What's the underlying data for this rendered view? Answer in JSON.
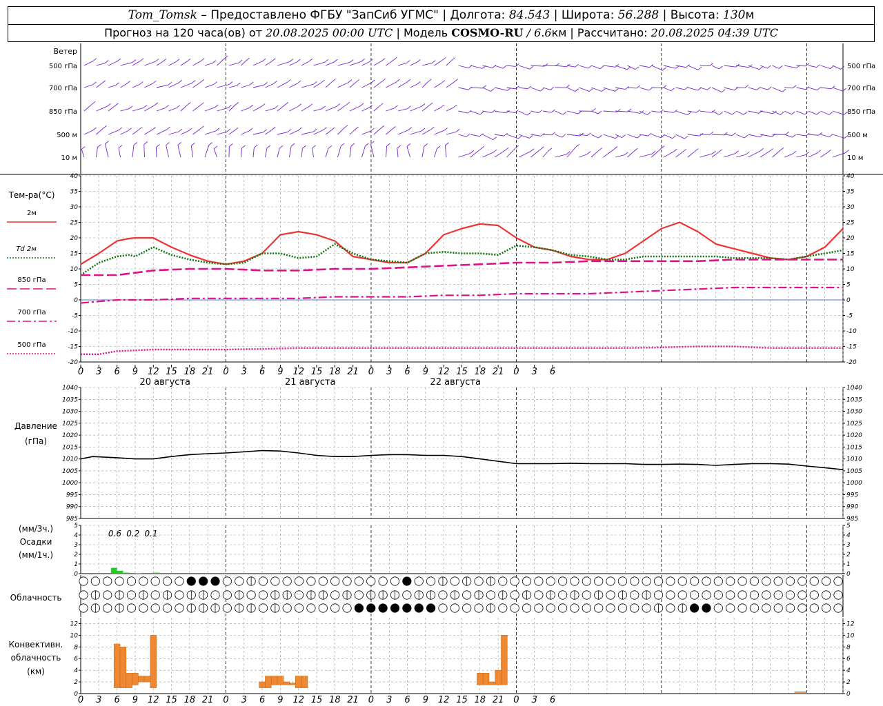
{
  "header": {
    "station": "Tom_Tomsk",
    "provider": " – Предоставлено ФГБУ \"ЗапСиб УГМС\" | Долгота: ",
    "lon": "84.543",
    "lat_label": " | Широта: ",
    "lat": "56.288",
    "alt_label": " | Высота: ",
    "alt": "130",
    "alt_unit": "м",
    "forecast_label": "Прогноз на 120 часа(ов) от ",
    "forecast_time": "20.08.2025 00:00 UTC",
    "model_label": "  | Модель ",
    "model": "COSMO-RU",
    "model_res": " / 6.6",
    "model_res_unit": "км",
    "calc_label": " | Рассчитано: ",
    "calc_time": "20.08.2025 04:39 UTC"
  },
  "labels": {
    "wind": "Ветер",
    "levels": [
      "500 гПа",
      "700 гПа",
      "850 гПа",
      "500 м",
      "10  м"
    ],
    "temp_title": "Тем-ра(°C)",
    "temp_legend": [
      "2м",
      "Td  2м",
      "850 гПа",
      "700 гПа",
      "500 гПа"
    ],
    "pressure_title": "Давление",
    "pressure_unit": "(гПа)",
    "precip_top": "(мм/3ч.)",
    "precip_title": "Осадки",
    "precip_bottom": "(мм/1ч.)",
    "cloud_title": "Облачность",
    "conv_title": [
      "Конвективн.",
      "облачность",
      "(км)"
    ]
  },
  "colors": {
    "t2m": "#ee3333",
    "td2m": "#117711",
    "t850": "#dd1188",
    "t700": "#dd1188",
    "t500": "#dd1188",
    "wind": "#7722cc",
    "precip": "#22cc22",
    "conv": "#ee8833",
    "pressure": "#000000",
    "grid": "#999999"
  },
  "x_ticks": [
    "0",
    "3",
    "6",
    "9",
    "12",
    "15",
    "18",
    "21",
    "0",
    "3",
    "6",
    "9",
    "12",
    "15",
    "18",
    "21",
    "0",
    "3",
    "6",
    "9",
    "12",
    "15",
    "18",
    "21",
    "0",
    "3",
    "6"
  ],
  "day_labels": [
    "20 августа",
    "21 августа",
    "22 августа"
  ],
  "chart_data": [
    {
      "type": "line",
      "title": "Тем-ра(°C)",
      "x_unit": "hours from 20.08.2025 00:00 UTC",
      "ylim": [
        -20,
        40
      ],
      "yticks": [
        -20,
        -15,
        -10,
        -5,
        0,
        5,
        10,
        15,
        20,
        25,
        30,
        35,
        40
      ],
      "series": [
        {
          "name": "2м",
          "style": "solid",
          "x": [
            0,
            3,
            6,
            8,
            9,
            12,
            15,
            18,
            21,
            24,
            27,
            30,
            33,
            36,
            39,
            42,
            45,
            48,
            51,
            54,
            57,
            60,
            63,
            66,
            69,
            72,
            75,
            78,
            81,
            84,
            87,
            90,
            93,
            96,
            99,
            102,
            105,
            108,
            111,
            114,
            117,
            120,
            123,
            126
          ],
          "y": [
            11.5,
            15,
            19,
            19.8,
            20,
            20,
            17,
            14.5,
            12.5,
            11.5,
            12.5,
            15,
            21,
            22,
            21,
            19,
            14,
            13,
            12,
            12,
            15,
            21,
            23,
            24.5,
            24,
            20,
            17,
            16,
            14,
            13,
            13,
            15,
            19,
            23,
            25,
            22,
            18,
            16.5,
            15,
            13.5,
            13,
            14,
            17,
            23
          ]
        },
        {
          "name": "Td  2м",
          "style": "dotted",
          "x": [
            0,
            3,
            6,
            8,
            9,
            12,
            15,
            18,
            21,
            24,
            27,
            30,
            33,
            36,
            39,
            42,
            45,
            48,
            51,
            54,
            57,
            60,
            63,
            66,
            69,
            72,
            75,
            78,
            81,
            84,
            87,
            90,
            93,
            96,
            99,
            102,
            105,
            108,
            111,
            114,
            117,
            120,
            123,
            126
          ],
          "y": [
            8,
            12,
            14,
            14.5,
            14,
            17,
            14.5,
            13,
            12,
            11.5,
            12,
            15,
            15,
            13.5,
            14,
            18,
            15,
            13,
            12.5,
            12,
            15,
            15.5,
            15,
            15,
            14.5,
            17.5,
            17,
            16,
            14.5,
            14,
            13,
            13,
            14,
            14,
            14,
            14,
            14,
            13.5,
            13.5,
            13.5,
            13,
            14,
            15,
            16
          ]
        },
        {
          "name": "850 гПа",
          "style": "longdash",
          "x": [
            0,
            6,
            12,
            18,
            24,
            30,
            36,
            42,
            48,
            54,
            60,
            66,
            72,
            78,
            84,
            90,
            96,
            102,
            108,
            114,
            120,
            126
          ],
          "y": [
            8,
            8,
            9.5,
            10,
            10,
            9.5,
            9.5,
            10,
            10,
            10.5,
            11,
            11.5,
            12,
            12,
            12.5,
            12.5,
            12.5,
            12.5,
            13,
            13,
            13,
            13
          ]
        },
        {
          "name": "700 гПа",
          "style": "dashdot",
          "x": [
            0,
            6,
            12,
            18,
            24,
            30,
            36,
            42,
            48,
            54,
            60,
            66,
            72,
            78,
            84,
            90,
            96,
            102,
            108,
            114,
            120,
            126
          ],
          "y": [
            -1,
            0,
            0,
            0.5,
            0.5,
            0.5,
            0.5,
            1,
            1,
            1,
            1.5,
            1.5,
            2,
            2,
            2,
            2.5,
            3,
            3.5,
            4,
            4,
            4,
            4
          ]
        },
        {
          "name": "500 гПа",
          "style": "dotted",
          "x": [
            0,
            3,
            6,
            12,
            18,
            24,
            30,
            36,
            42,
            48,
            54,
            60,
            66,
            72,
            78,
            84,
            90,
            96,
            102,
            108,
            114,
            120,
            126
          ],
          "y": [
            -17.5,
            -17.5,
            -16.5,
            -16,
            -16,
            -16,
            -15.8,
            -15.5,
            -15.5,
            -15.5,
            -15.5,
            -15.5,
            -15.5,
            -15.5,
            -15.5,
            -15.5,
            -15.5,
            -15.3,
            -15,
            -15,
            -15.5,
            -15.5,
            -15.5
          ]
        }
      ]
    },
    {
      "type": "line",
      "title": "Давление",
      "ylabel": "(гПа)",
      "ylim": [
        985,
        1040
      ],
      "yticks": [
        985,
        990,
        995,
        1000,
        1005,
        1010,
        1015,
        1020,
        1025,
        1030,
        1035,
        1040
      ],
      "series": [
        {
          "name": "",
          "x": [
            0,
            2,
            6,
            9,
            12,
            15,
            18,
            21,
            24,
            27,
            30,
            33,
            36,
            39,
            42,
            45,
            48,
            51,
            54,
            57,
            60,
            63,
            66,
            69,
            72,
            75,
            78,
            81,
            84,
            87,
            90,
            93,
            96,
            99,
            102,
            105,
            108,
            111,
            114,
            117,
            120,
            123,
            126
          ],
          "y": [
            1010,
            1011,
            1010.5,
            1010,
            1010,
            1011,
            1011.8,
            1012.2,
            1012.5,
            1013,
            1013.5,
            1013.3,
            1012.5,
            1011.5,
            1011,
            1011,
            1011.5,
            1011.8,
            1011.8,
            1011.5,
            1011.5,
            1011,
            1010,
            1009,
            1008,
            1008,
            1008,
            1008.2,
            1008,
            1008,
            1008,
            1007.7,
            1007.7,
            1007.8,
            1007.7,
            1007.3,
            1007.7,
            1008,
            1008,
            1007.8,
            1007,
            1006.3,
            1005.5
          ]
        }
      ]
    },
    {
      "type": "bar",
      "title": "Осадки",
      "ylabel": "(мм/1ч.)",
      "ylim": [
        0,
        5
      ],
      "yticks": [
        0,
        1,
        2,
        3,
        4,
        5
      ],
      "x": [
        5.5,
        6.5,
        7.5,
        9.5,
        12.5
      ],
      "values": [
        0.6,
        0.3,
        0.1,
        0.05,
        0.1
      ],
      "annotations": [
        {
          "x": 4.5,
          "text": "0.6"
        },
        {
          "x": 7.5,
          "text": "0.2"
        },
        {
          "x": 10.5,
          "text": "0.1"
        }
      ]
    },
    {
      "type": "bar",
      "title": "Конвективн. облачность",
      "ylabel": "(км)",
      "ylim": [
        0,
        13
      ],
      "yticks": [
        0,
        2,
        4,
        6,
        8,
        10,
        12
      ],
      "bars": [
        {
          "x0": 5.5,
          "x1": 6.5,
          "base": 1,
          "top": 8.5
        },
        {
          "x0": 6.5,
          "x1": 7.5,
          "base": 1,
          "top": 8
        },
        {
          "x0": 7.5,
          "x1": 8.5,
          "base": 1,
          "top": 3.5
        },
        {
          "x0": 8.5,
          "x1": 9.5,
          "base": 1.5,
          "top": 3.5
        },
        {
          "x0": 9.5,
          "x1": 10.5,
          "base": 2,
          "top": 3
        },
        {
          "x0": 10.5,
          "x1": 11.5,
          "base": 2,
          "top": 3
        },
        {
          "x0": 11.5,
          "x1": 12.5,
          "base": 1,
          "top": 10
        },
        {
          "x0": 29.5,
          "x1": 30.5,
          "base": 1,
          "top": 2
        },
        {
          "x0": 30.5,
          "x1": 31.5,
          "base": 1,
          "top": 3
        },
        {
          "x0": 31.5,
          "x1": 32.5,
          "base": 1.5,
          "top": 3
        },
        {
          "x0": 32.5,
          "x1": 33.5,
          "base": 1.5,
          "top": 3
        },
        {
          "x0": 33.5,
          "x1": 34.5,
          "base": 1.5,
          "top": 2
        },
        {
          "x0": 34.5,
          "x1": 35.5,
          "base": 1.5,
          "top": 1.8
        },
        {
          "x0": 35.5,
          "x1": 36.5,
          "base": 1,
          "top": 3
        },
        {
          "x0": 36.5,
          "x1": 37.5,
          "base": 1,
          "top": 3
        },
        {
          "x0": 65.5,
          "x1": 66.5,
          "base": 1.5,
          "top": 3.5
        },
        {
          "x0": 66.5,
          "x1": 67.5,
          "base": 1.5,
          "top": 3.5
        },
        {
          "x0": 67.5,
          "x1": 68.5,
          "base": 1.5,
          "top": 2
        },
        {
          "x0": 68.5,
          "x1": 69.5,
          "base": 1.5,
          "top": 4
        },
        {
          "x0": 69.5,
          "x1": 70.5,
          "base": 1.5,
          "top": 10
        },
        {
          "x0": 118,
          "x1": 120,
          "base": 0.2,
          "top": 0.3
        }
      ]
    },
    {
      "type": "heatmap",
      "title": "Облачность",
      "rows": 3,
      "cols": 64,
      "fill_eighths": [
        "0000000008880040000000000008004040400000000000000000000000000000005004440880044888888848888888888886",
        "0404040404400400440440404440440404040404040404040000000000000000000000000040404040404040404088488488",
        "0404000004440440400000088888880000400000000000004048800000000000000000000000400048888888880000000000"
      ]
    }
  ]
}
